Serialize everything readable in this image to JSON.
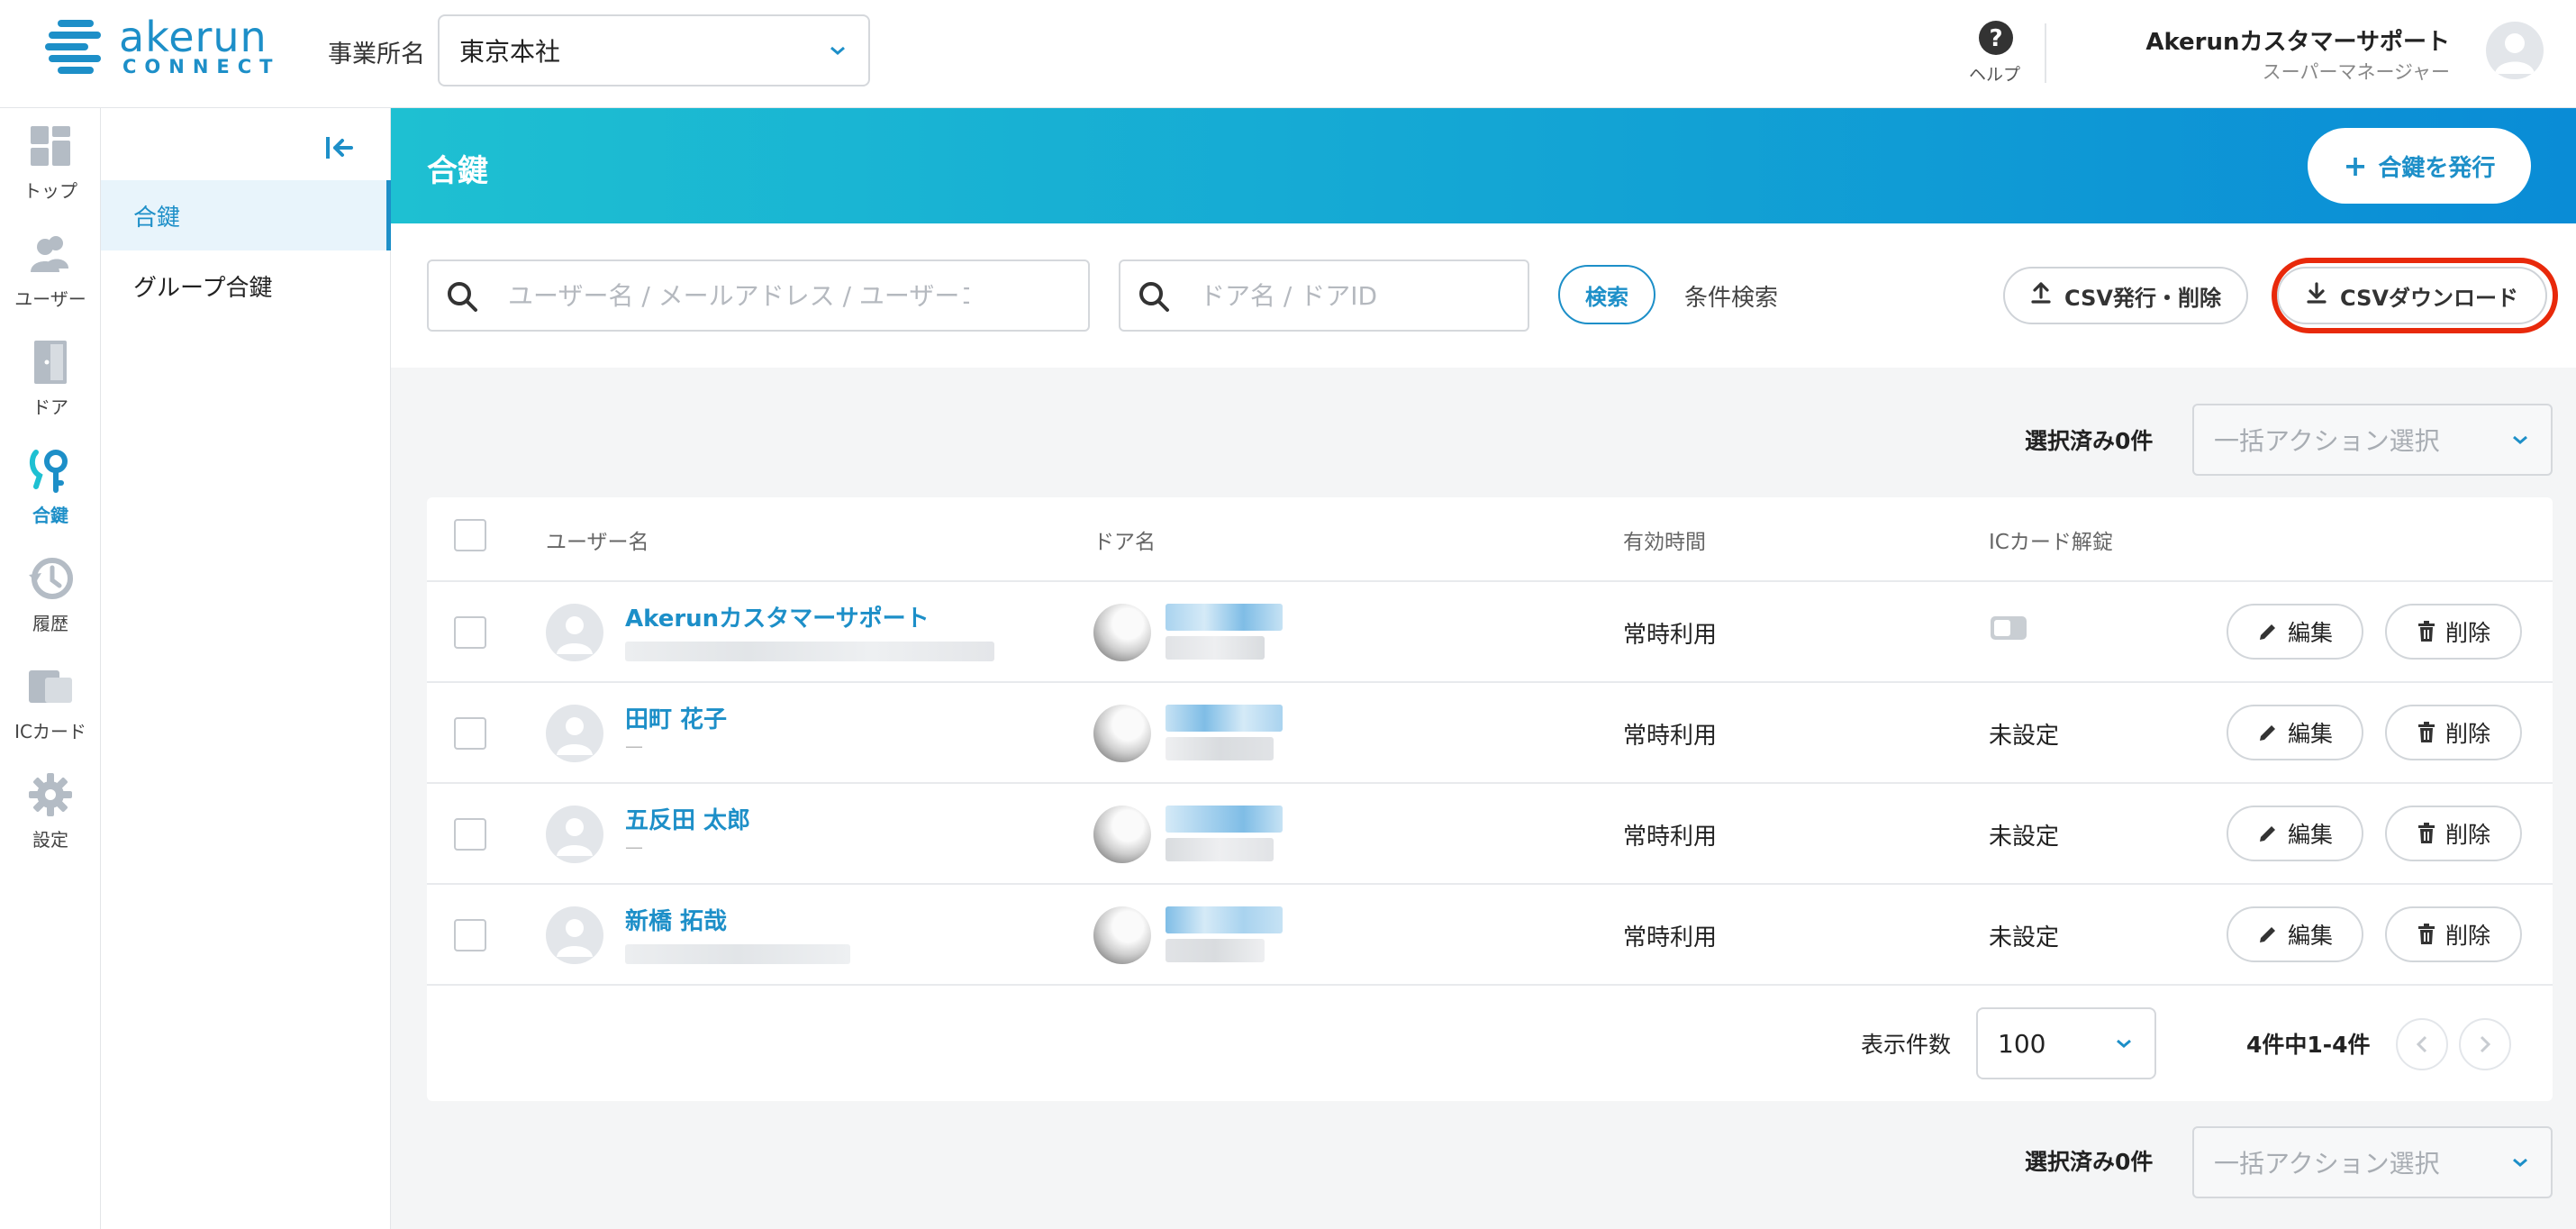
{
  "header": {
    "logo_text": "akerun",
    "logo_sub": "CONNECT",
    "office_label": "事業所名",
    "office_value": "東京本社",
    "help_label": "ヘルプ",
    "user_name": "Akerunカスタマーサポート",
    "user_role": "スーパーマネージャー"
  },
  "nav": {
    "items": [
      {
        "label": "トップ",
        "icon": "dashboard-icon"
      },
      {
        "label": "ユーザー",
        "icon": "users-icon"
      },
      {
        "label": "ドア",
        "icon": "door-icon"
      },
      {
        "label": "合鍵",
        "icon": "key-icon",
        "active": true
      },
      {
        "label": "履歴",
        "icon": "history-icon"
      },
      {
        "label": "ICカード",
        "icon": "ic-card-icon"
      },
      {
        "label": "設定",
        "icon": "gear-icon"
      }
    ]
  },
  "subnav": {
    "items": [
      {
        "label": "合鍵",
        "active": true
      },
      {
        "label": "グループ合鍵"
      }
    ]
  },
  "page": {
    "title": "合鍵",
    "issue_button": "合鍵を発行"
  },
  "toolbar": {
    "user_search_placeholder": "ユーザー名 / メールアドレス / ユーザーコード",
    "door_search_placeholder": "ドア名 / ドアID",
    "search_button": "検索",
    "advanced_search": "条件検索",
    "csv_issue_button": "CSV発行・削除",
    "csv_download_button": "CSVダウンロード"
  },
  "bulk": {
    "selected_label": "選択済み0件",
    "action_placeholder": "一括アクション選択"
  },
  "table": {
    "columns": [
      "ユーザー名",
      "ドア名",
      "有効時間",
      "ICカード解錠"
    ],
    "rows": [
      {
        "user": "Akerunカスタマーサポート",
        "sub": "",
        "validity": "常時利用",
        "ic": "",
        "ic_toggle": true
      },
      {
        "user": "田町 花子",
        "sub": "—",
        "validity": "常時利用",
        "ic": "未設定"
      },
      {
        "user": "五反田 太郎",
        "sub": "—",
        "validity": "常時利用",
        "ic": "未設定"
      },
      {
        "user": "新橋 拓哉",
        "sub": "",
        "validity": "常時利用",
        "ic": "未設定"
      }
    ],
    "edit_label": "編集",
    "delete_label": "削除"
  },
  "pagination": {
    "per_page_label": "表示件数",
    "per_page_value": "100",
    "range_text": "4件中1-4件"
  },
  "colors": {
    "accent": "#1d8fc8",
    "banner_start": "#1ec0d2",
    "banner_end": "#0a8cd6",
    "highlight": "#e8290b"
  }
}
